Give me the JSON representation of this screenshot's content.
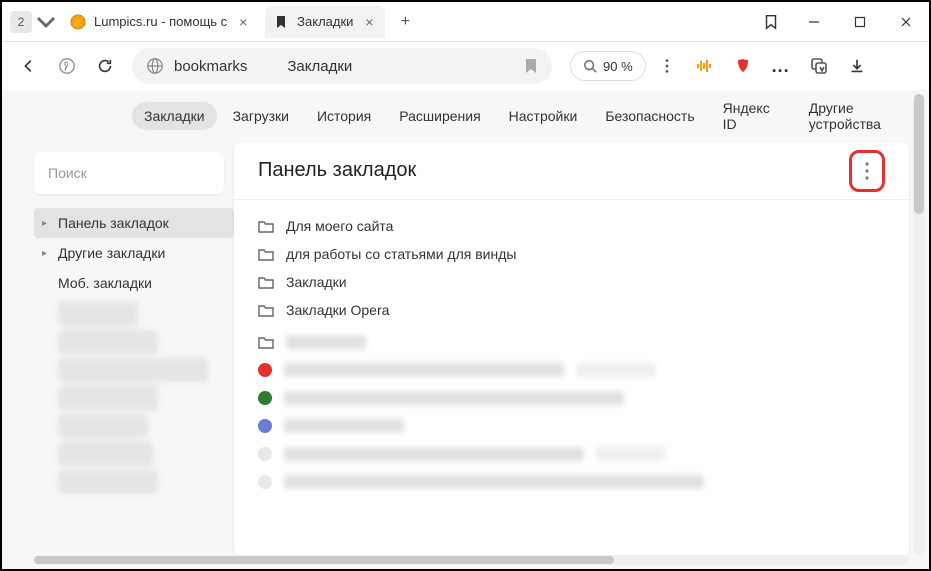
{
  "titlebar": {
    "tab_count": "2",
    "tabs": [
      {
        "title": "Lumpics.ru - помощь с"
      },
      {
        "title": "Закладки"
      }
    ]
  },
  "toolbar": {
    "url": "bookmarks",
    "page_title": "Закладки",
    "zoom": "90 %"
  },
  "categories": [
    "Закладки",
    "Загрузки",
    "История",
    "Расширения",
    "Настройки",
    "Безопасность",
    "Яндекс ID",
    "Другие устройства"
  ],
  "sidebar": {
    "search_placeholder": "Поиск",
    "tree": [
      {
        "label": "Панель закладок",
        "expandable": true,
        "selected": true
      },
      {
        "label": "Другие закладки",
        "expandable": true,
        "selected": false
      },
      {
        "label": "Моб. закладки",
        "expandable": false,
        "selected": false
      }
    ]
  },
  "content": {
    "heading": "Панель закладок",
    "folders": [
      "Для моего сайта",
      "для работы со статьями для винды",
      "Закладки",
      "Закладки Opera"
    ]
  }
}
